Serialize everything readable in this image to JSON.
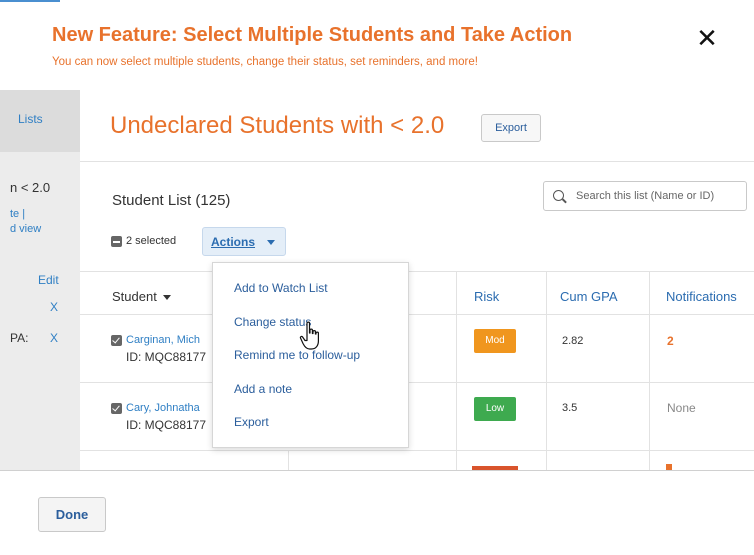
{
  "banner": {
    "title": "New Feature: Select Multiple Students and Take Action",
    "subtitle": "You can now select multiple students, change their status, set reminders, and more!",
    "close_label": "✕"
  },
  "sidebar": {
    "lists_label": "Lists",
    "text1": "n < 2.0",
    "text2": "te |",
    "text3": "d view",
    "edit_label": "Edit",
    "x1": "X",
    "pa_label": "PA:",
    "x2": "X"
  },
  "page": {
    "title": "Undeclared Students with < 2.0",
    "export_label": "Export"
  },
  "list": {
    "title": "Student List (125)",
    "search_placeholder": "Search this list (Name or ID)",
    "selected_text": "2 selected",
    "actions_label": "Actions"
  },
  "table": {
    "columns": [
      "Student",
      "Risk",
      "Cum GPA",
      "Notifications"
    ],
    "rows": [
      {
        "name": "Carginan, Mich",
        "id": "ID: MQC88177",
        "risk": "Mod",
        "risk_color": "#f0961e",
        "gpa": "2.82",
        "notifications": "2",
        "notif_color": "#e8722c"
      },
      {
        "name": "Cary, Johnatha",
        "id": "ID: MQC88177",
        "risk": "Low",
        "risk_color": "#3eaa4f",
        "gpa": "3.5",
        "notifications": "None",
        "notif_color": "#888888"
      }
    ]
  },
  "dropdown": {
    "items": [
      "Add to Watch List",
      "Change status",
      "Remind me to follow-up",
      "Add a note",
      "Export"
    ]
  },
  "footer": {
    "done_label": "Done"
  },
  "colors": {
    "accent": "#e8722c",
    "link": "#2f7fc4"
  }
}
